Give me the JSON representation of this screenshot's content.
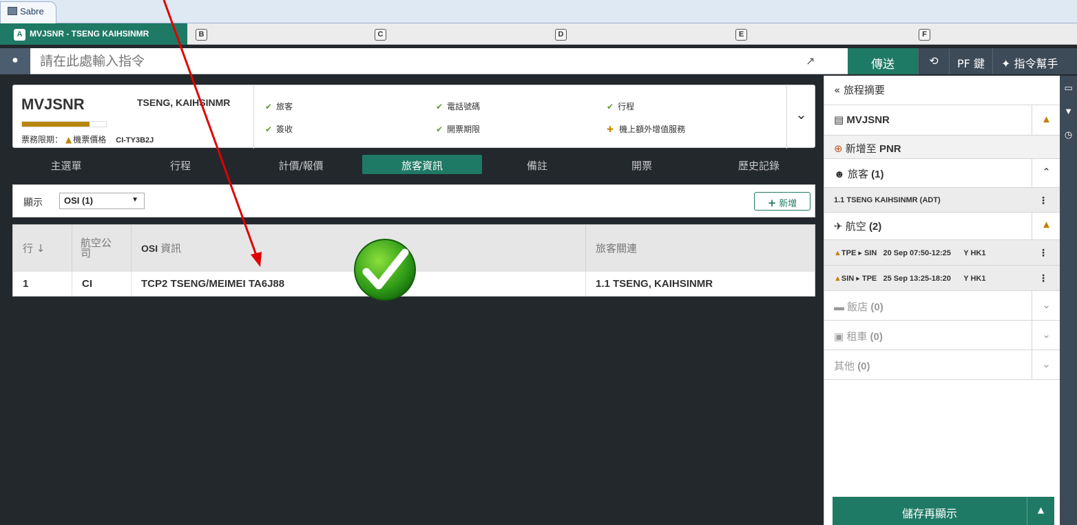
{
  "window": {
    "app_title": "Sabre"
  },
  "session_tabs": [
    {
      "letter": "A",
      "label": "MVJSNR - TSENG KAIHSINMR"
    },
    {
      "letter": "B",
      "label": ""
    },
    {
      "letter": "C",
      "label": ""
    },
    {
      "letter": "D",
      "label": ""
    },
    {
      "letter": "E",
      "label": ""
    },
    {
      "letter": "F",
      "label": ""
    }
  ],
  "command_bar": {
    "placeholder": "請在此處輸入指令",
    "send_label": "傳送",
    "history_icon": "history-icon",
    "pf_label": "PF 鍵",
    "helper_label": "指令幫手"
  },
  "pnr": {
    "record_locator": "MVJSNR",
    "passenger_name": "TSENG, KAIHSINMR",
    "progress_fraction": 0.8,
    "ticketing_label": "票務限期：",
    "fare_warning": "機票價格",
    "fare_code": "CI-TY3B2J",
    "checks": [
      {
        "label": "旅客",
        "status": "ok"
      },
      {
        "label": "電話號碼",
        "status": "ok"
      },
      {
        "label": "行程",
        "status": "ok"
      },
      {
        "label": "簽收",
        "status": "ok"
      },
      {
        "label": "開票期限",
        "status": "ok"
      },
      {
        "label": "機上額外增值服務",
        "status": "add"
      }
    ]
  },
  "nav_tabs": [
    "主選單",
    "行程",
    "計價/報價",
    "旅客資訊",
    "備註",
    "開票",
    "歷史記錄"
  ],
  "active_nav_tab": "旅客資訊",
  "filter": {
    "show_label": "顯示",
    "selected": "OSI (1)",
    "add_label": "新增"
  },
  "osi_table": {
    "headers": [
      "行",
      "航空公司",
      "OSI 資訊",
      "旅客關連"
    ],
    "header_osi_bold": "OSI",
    "header_osi_rest": "資訊",
    "rows": [
      {
        "line": "1",
        "airline": "CI",
        "info": "TCP2 TSENG/MEIMEI TA6J88",
        "passenger": "1.1 TSENG, KAIHSINMR"
      }
    ]
  },
  "sidebar": {
    "summary_label": "旅程摘要",
    "pnr_label": "MVJSNR",
    "add_to_pnr_prefix": "新增至",
    "add_to_pnr_suffix": "PNR",
    "passengers_label": "旅客",
    "passengers_count": "(1)",
    "passenger_item": "1.1 TSENG KAIHSINMR (ADT)",
    "air_label": "航空",
    "air_count": "(2)",
    "segments": [
      {
        "from": "TPE",
        "to": "SIN",
        "date_time": "20 Sep 07:50-12:25",
        "status": "Y HK1"
      },
      {
        "from": "SIN",
        "to": "TPE",
        "date_time": "25 Sep 13:25-18:20",
        "status": "Y HK1"
      }
    ],
    "hotel_label": "飯店",
    "hotel_count": "(0)",
    "car_label": "租車",
    "car_count": "(0)",
    "other_label": "其他",
    "other_count": "(0)",
    "save_label": "儲存再顯示"
  },
  "colors": {
    "accent": "#1f7a65",
    "dark_panel": "#23282d",
    "warning": "#c08000",
    "check": "#5a9e2f",
    "annotation_arrow": "#e00000"
  }
}
